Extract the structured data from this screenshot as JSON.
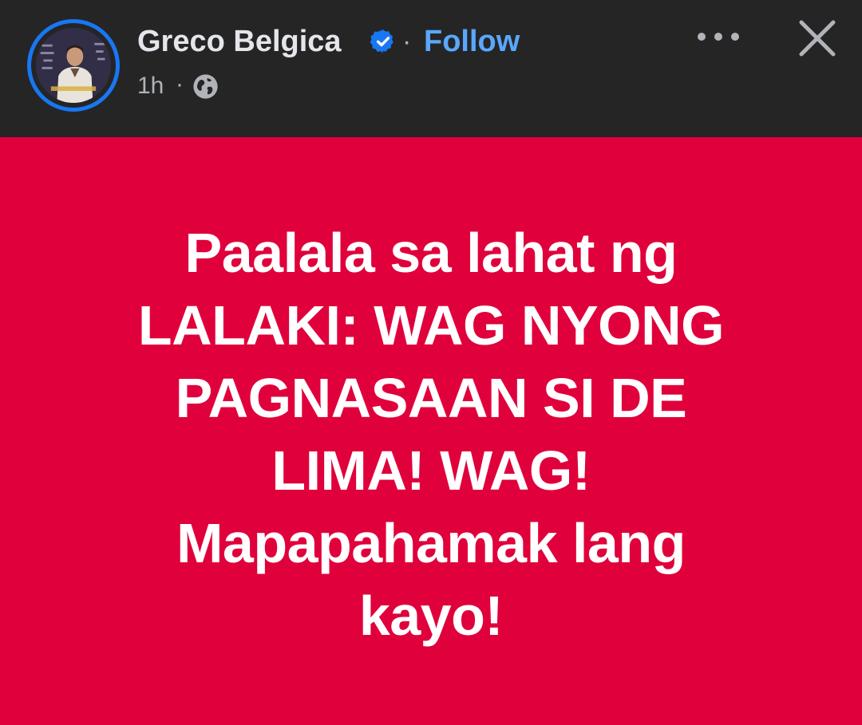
{
  "post": {
    "author": "Greco Belgica",
    "separator": "·",
    "follow_label": "Follow",
    "timestamp": "1h",
    "time_separator": "·",
    "privacy_icon": "globe-icon",
    "lines": [
      "Paalala sa lahat ng",
      "LALAKI: WAG NYONG",
      "PAGNASAAN SI DE",
      "LIMA! WAG!",
      "Mapapahamak lang",
      "kayo!"
    ],
    "background_color": "#e0003b"
  },
  "header": {
    "more_icon": "more-options-icon",
    "close_icon": "close-icon"
  },
  "colors": {
    "header_bg": "#252526",
    "accent": "#1877f2",
    "follow_text": "#5aa7ff"
  }
}
